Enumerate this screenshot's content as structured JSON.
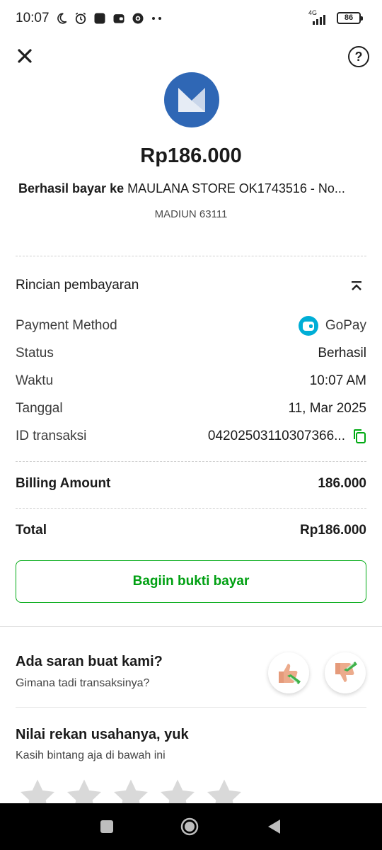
{
  "status_bar": {
    "time": "10:07",
    "network": "4G",
    "battery": "86"
  },
  "header": {
    "close_icon": "close-icon",
    "help_icon": "help-icon",
    "help_glyph": "?"
  },
  "receipt": {
    "amount": "Rp186.000",
    "paid_prefix": "Berhasil bayar ke ",
    "merchant_name": "MAULANA STORE OK1743516 - No...",
    "city": "MADIUN 63111"
  },
  "details": {
    "section_title": "Rincian pembayaran",
    "payment_method_label": "Payment Method",
    "payment_method_value": "GoPay",
    "status_label": "Status",
    "status_value": "Berhasil",
    "time_label": "Waktu",
    "time_value": "10:07 AM",
    "date_label": "Tanggal",
    "date_value": "11, Mar 2025",
    "txn_label": "ID transaksi",
    "txn_value": "04202503110307366..."
  },
  "summary": {
    "billing_label": "Billing Amount",
    "billing_value": "186.000",
    "total_label": "Total",
    "total_value": "Rp186.000"
  },
  "share_button": "Bagiin bukti bayar",
  "feedback": {
    "title": "Ada saran buat kami?",
    "subtitle": "Gimana tadi transaksinya?"
  },
  "rating": {
    "title": "Nilai rekan usahanya, yuk",
    "subtitle": "Kasih bintang aja di bawah ini",
    "stars": 5
  },
  "colors": {
    "accent_green": "#00aa13",
    "merchant_blue": "#2f67b5",
    "gopay_blue": "#00aed6"
  }
}
